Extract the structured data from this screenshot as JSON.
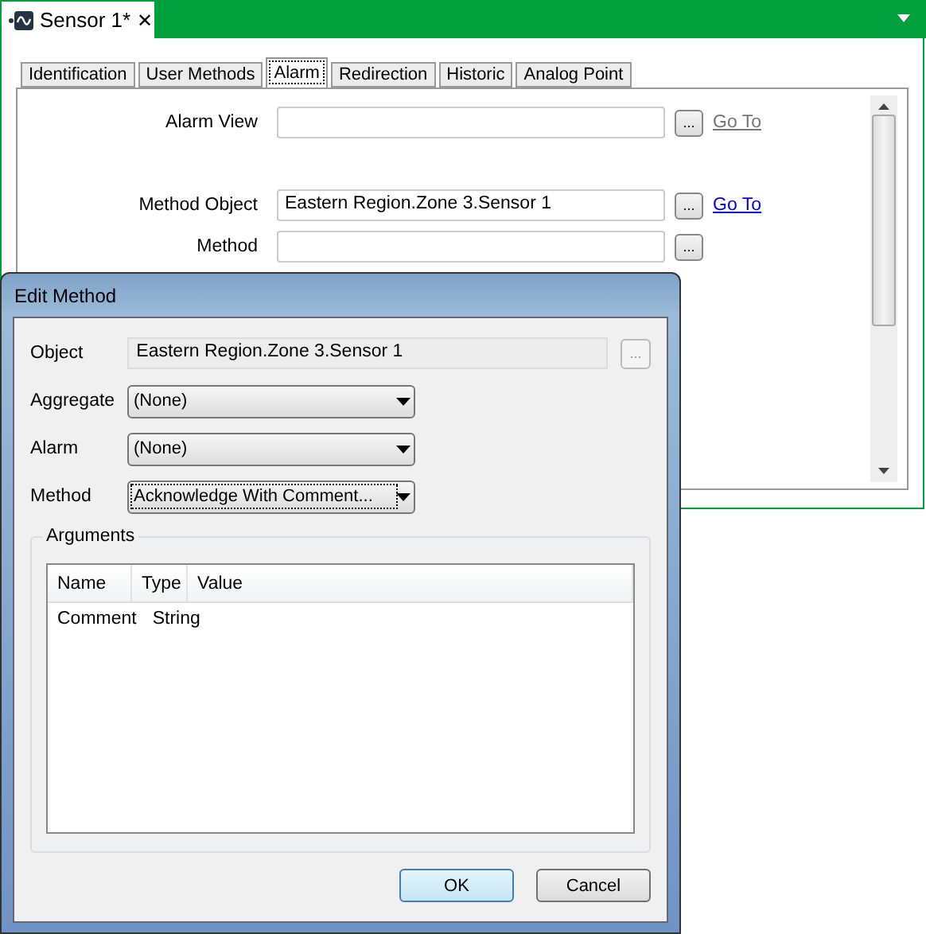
{
  "document_tab": {
    "title": "Sensor 1*",
    "close": "✕"
  },
  "tabs": [
    {
      "label": "Identification",
      "selected": false
    },
    {
      "label": "User Methods",
      "selected": false
    },
    {
      "label": "Alarm",
      "selected": true
    },
    {
      "label": "Redirection",
      "selected": false
    },
    {
      "label": "Historic",
      "selected": false
    },
    {
      "label": "Analog Point",
      "selected": false
    }
  ],
  "form_rows": [
    {
      "label": "Alarm View",
      "value": "",
      "browse": "...",
      "link": {
        "label": "Go To",
        "disabled": true
      }
    },
    {
      "label": "Method Object",
      "value": "Eastern Region.Zone 3.Sensor 1",
      "browse": "...",
      "link": {
        "label": "Go To",
        "disabled": false
      }
    },
    {
      "label": "Method",
      "value": "",
      "browse": "..."
    }
  ],
  "dialog": {
    "title": "Edit Method",
    "object": {
      "label": "Object",
      "value": "Eastern Region.Zone 3.Sensor 1",
      "browse": "...",
      "disabled": true
    },
    "dropdowns": [
      {
        "label": "Aggregate",
        "value": "(None)",
        "focused": false
      },
      {
        "label": "Alarm",
        "value": "(None)",
        "focused": false
      },
      {
        "label": "Method",
        "value": "Acknowledge With Comment...",
        "focused": true
      }
    ],
    "arguments": {
      "title": "Arguments",
      "columns": [
        "Name",
        "Type",
        "Value"
      ],
      "rows": [
        [
          "Comment",
          "String",
          ""
        ]
      ]
    },
    "buttons": [
      {
        "label": "OK",
        "default": true
      },
      {
        "label": "Cancel",
        "default": false
      }
    ]
  }
}
